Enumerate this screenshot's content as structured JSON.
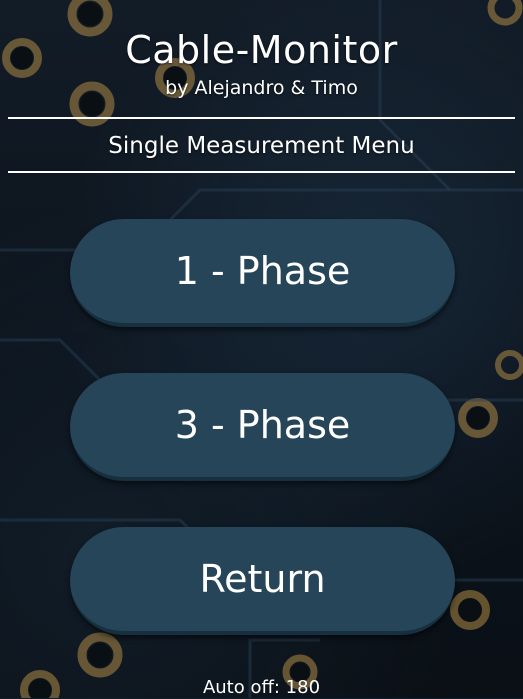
{
  "header": {
    "title": "Cable-Monitor",
    "subtitle": "by Alejandro & Timo"
  },
  "menu": {
    "title": "Single Measurement Menu",
    "buttons": [
      {
        "label": "1 - Phase"
      },
      {
        "label": "3 - Phase"
      },
      {
        "label": "Return"
      }
    ]
  },
  "status": {
    "auto_off": "Auto off: 180"
  },
  "colors": {
    "button_fill": "#264559",
    "text": "#ffffff",
    "background": "#0d141c"
  }
}
